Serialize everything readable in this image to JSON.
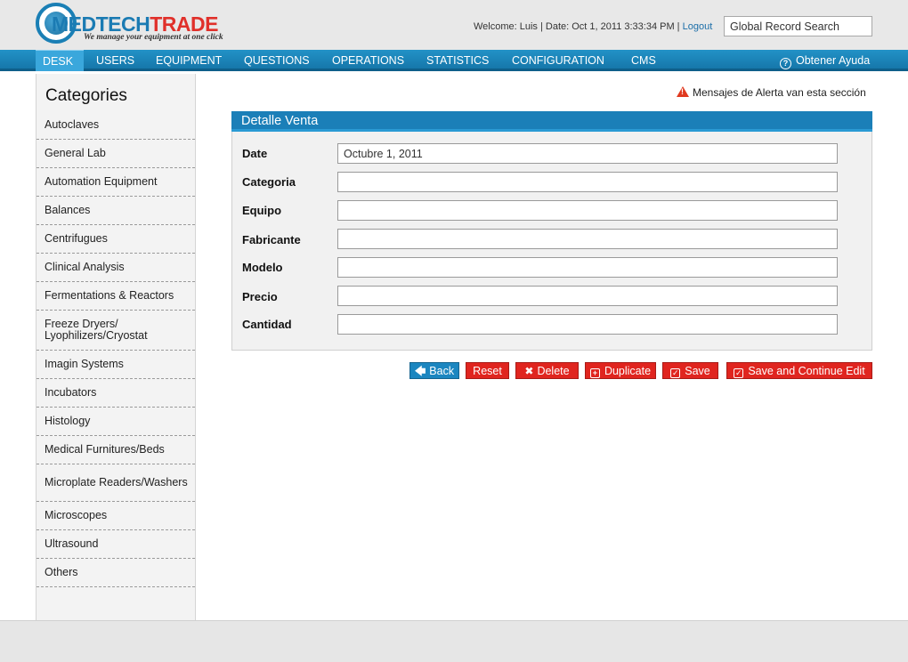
{
  "header": {
    "logo": {
      "part1": "MEDTECH",
      "part2": "TRADE",
      "tagline": "We manage your equipment at one click"
    },
    "welcome_text": "Welcome: Luis | Date: Oct 1, 2011 3:33:34 PM |",
    "logout_label": "Logout",
    "search_value": "Global Record Search"
  },
  "nav": {
    "items": [
      {
        "label": "DESK",
        "active": true
      },
      {
        "label": "USERS"
      },
      {
        "label": "EQUIPMENT"
      },
      {
        "label": "QUESTIONS"
      },
      {
        "label": "OPERATIONS"
      },
      {
        "label": "STATISTICS"
      },
      {
        "label": "CONFIGURATION"
      },
      {
        "label": "CMS"
      }
    ],
    "help_label": "Obtener Ayuda"
  },
  "sidebar": {
    "title": "Categories",
    "items": [
      {
        "label": "Autoclaves"
      },
      {
        "label": "General Lab"
      },
      {
        "label": "Automation Equipment"
      },
      {
        "label": "Balances"
      },
      {
        "label": "Centrifugues"
      },
      {
        "label": "Clinical Analysis"
      },
      {
        "label": "Fermentations & Reactors"
      },
      {
        "label": "Freeze Dryers/ Lyophilizers/Cryostat"
      },
      {
        "label": "Imagin Systems"
      },
      {
        "label": "Incubators"
      },
      {
        "label": "Histology"
      },
      {
        "label": "Medical Furnitures/Beds"
      },
      {
        "label": "Microplate Readers/Washers"
      },
      {
        "label": "Microscopes"
      },
      {
        "label": "Ultrasound"
      },
      {
        "label": "Others"
      }
    ]
  },
  "alert_text": "Mensajes de Alerta van esta sección",
  "panel": {
    "title": "Detalle Venta",
    "fields": [
      {
        "label": "Date",
        "value": "Octubre 1, 2011"
      },
      {
        "label": "Categoria",
        "value": ""
      },
      {
        "label": "Equipo",
        "value": ""
      },
      {
        "label": "Fabricante",
        "value": ""
      },
      {
        "label": "Modelo",
        "value": ""
      },
      {
        "label": "Precio",
        "value": ""
      },
      {
        "label": "Cantidad",
        "value": ""
      }
    ]
  },
  "buttons": {
    "back": "Back",
    "reset": "Reset",
    "delete": "Delete",
    "duplicate": "Duplicate",
    "save": "Save",
    "save_continue": "Save and Continue Edit"
  },
  "colors": {
    "brand_blue": "#1b7fb8",
    "brand_red": "#e0251f",
    "nav_active": "#3aa7dc"
  }
}
